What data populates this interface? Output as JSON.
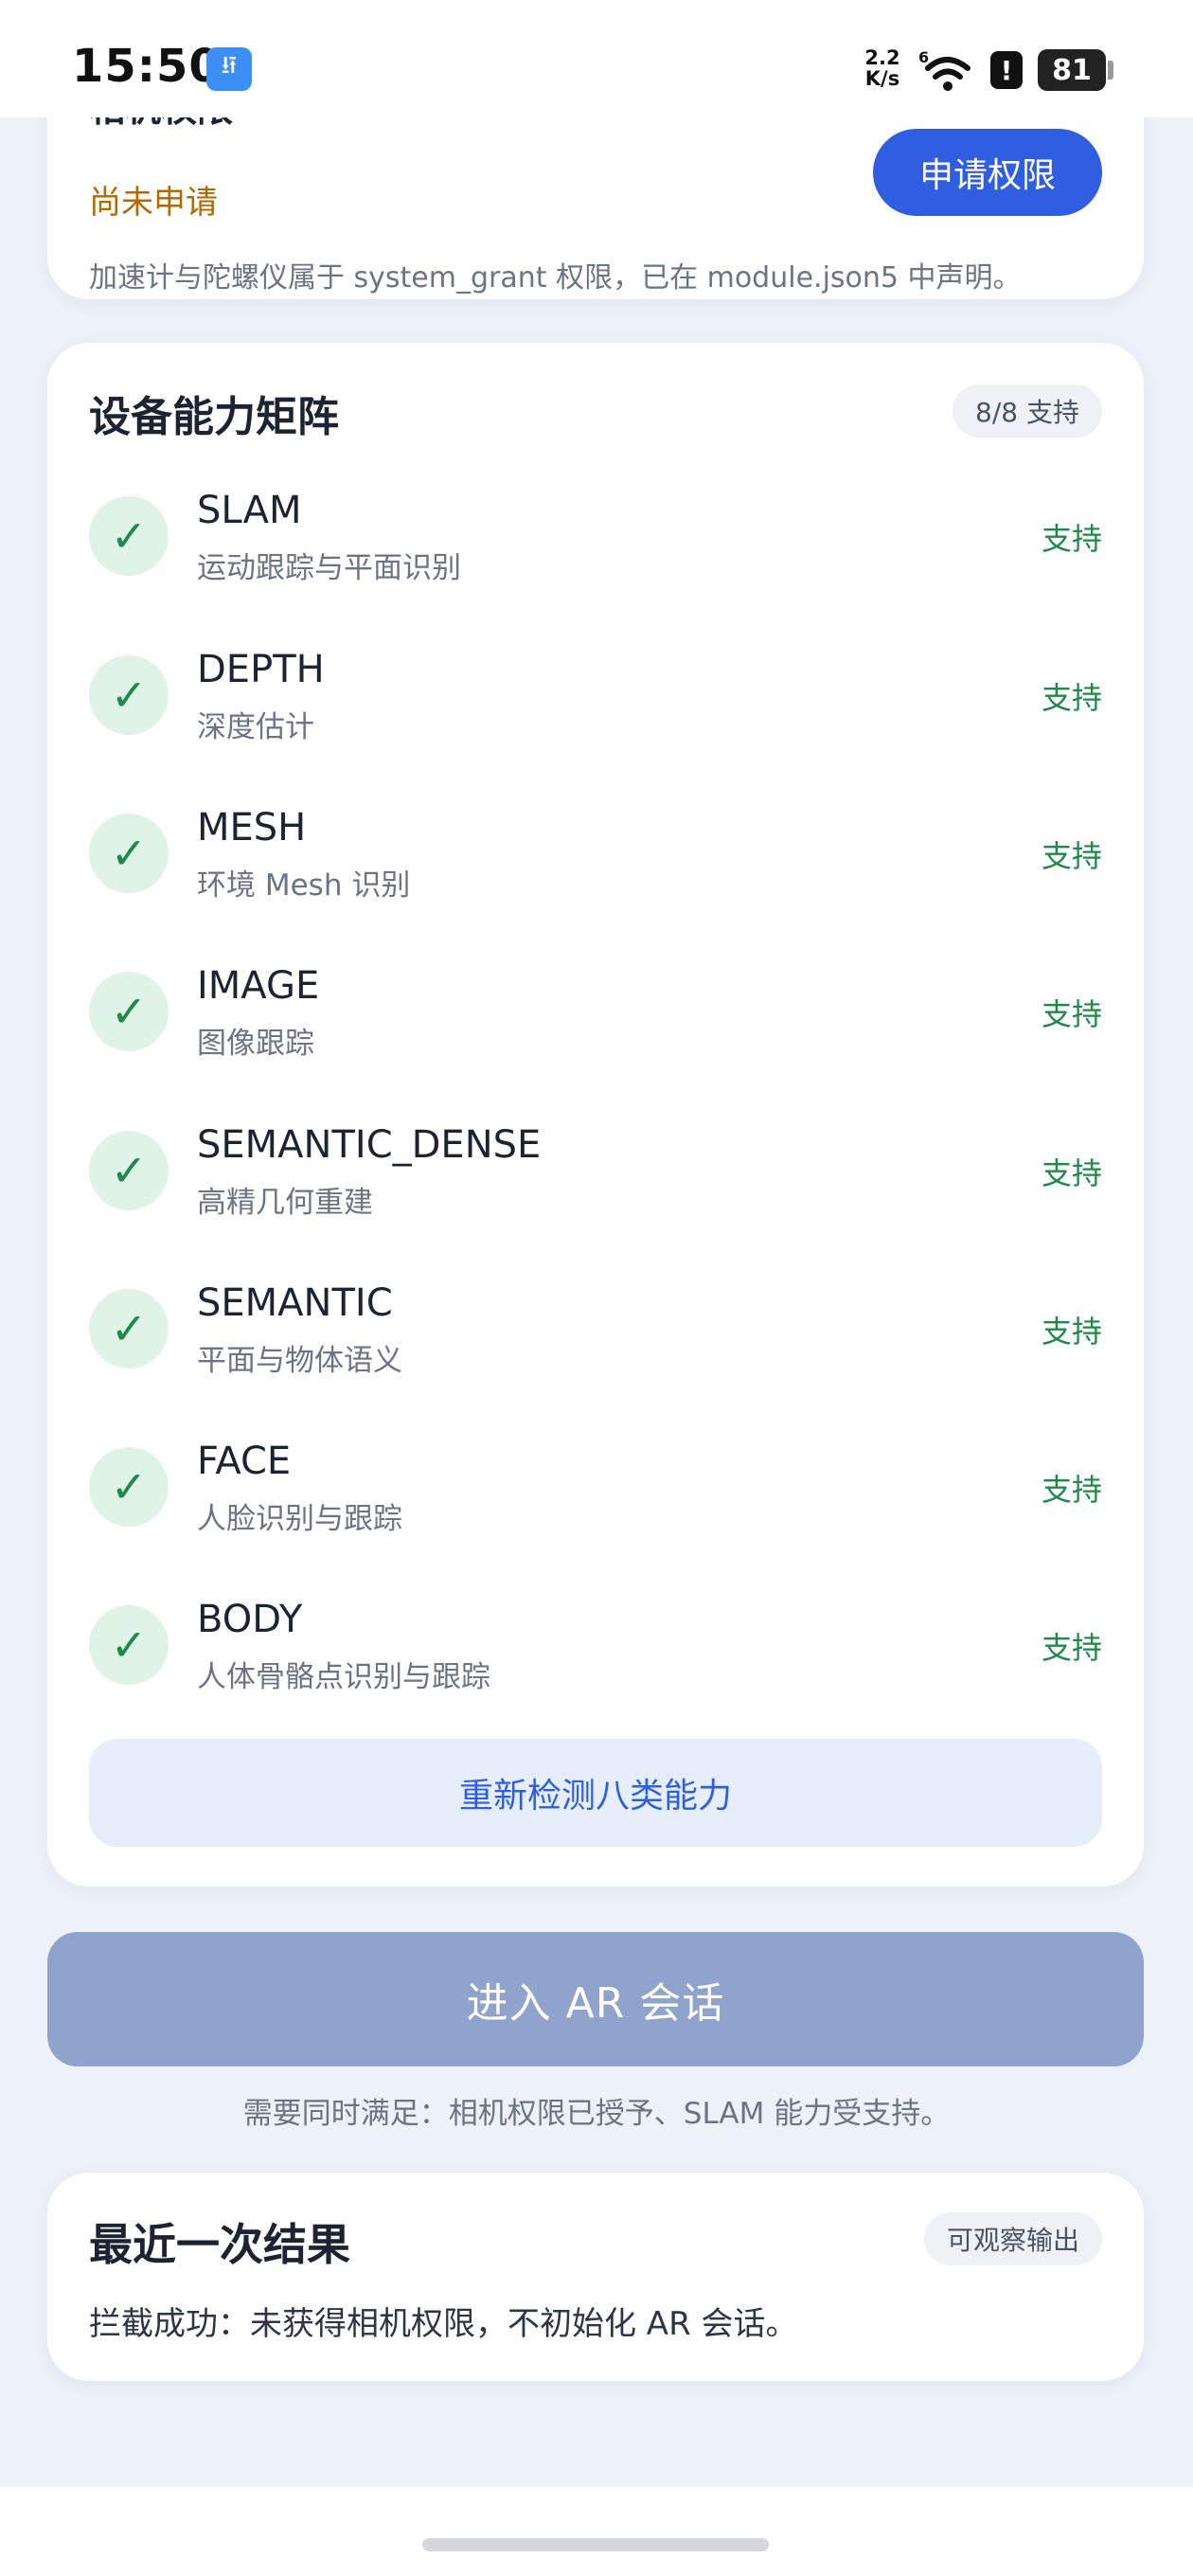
{
  "status_bar": {
    "time": "15:50",
    "usb_icon": "usb-icon",
    "speed_top": "2.2",
    "speed_bottom": "K/s",
    "wifi_label": "6",
    "alert": "!",
    "battery": "81"
  },
  "permission": {
    "title": "相机权限",
    "status": "尚未申请",
    "button": "申请权限",
    "note": "加速计与陀螺仪属于 system_grant 权限，已在 module.json5 中声明。"
  },
  "matrix": {
    "title": "设备能力矩阵",
    "badge": "8/8 支持",
    "check_icon": "✓",
    "items": [
      {
        "name": "SLAM",
        "desc": "运动跟踪与平面识别",
        "status": "支持"
      },
      {
        "name": "DEPTH",
        "desc": "深度估计",
        "status": "支持"
      },
      {
        "name": "MESH",
        "desc": "环境 Mesh 识别",
        "status": "支持"
      },
      {
        "name": "IMAGE",
        "desc": "图像跟踪",
        "status": "支持"
      },
      {
        "name": "SEMANTIC_DENSE",
        "desc": "高精几何重建",
        "status": "支持"
      },
      {
        "name": "SEMANTIC",
        "desc": "平面与物体语义",
        "status": "支持"
      },
      {
        "name": "FACE",
        "desc": "人脸识别与跟踪",
        "status": "支持"
      },
      {
        "name": "BODY",
        "desc": "人体骨骼点识别与跟踪",
        "status": "支持"
      }
    ],
    "recheck_button": "重新检测八类能力"
  },
  "enter": {
    "button": "进入 AR 会话",
    "hint": "需要同时满足：相机权限已授予、SLAM 能力受支持。"
  },
  "result": {
    "title": "最近一次结果",
    "badge": "可观察输出",
    "text": "拦截成功：未获得相机权限，不初始化 AR 会话。"
  },
  "colors": {
    "accent": "#2f5fe0",
    "success": "#1e8a4a",
    "warning": "#b26a00",
    "disabled_button": "#8fa3cc",
    "background": "#edf1f8"
  }
}
